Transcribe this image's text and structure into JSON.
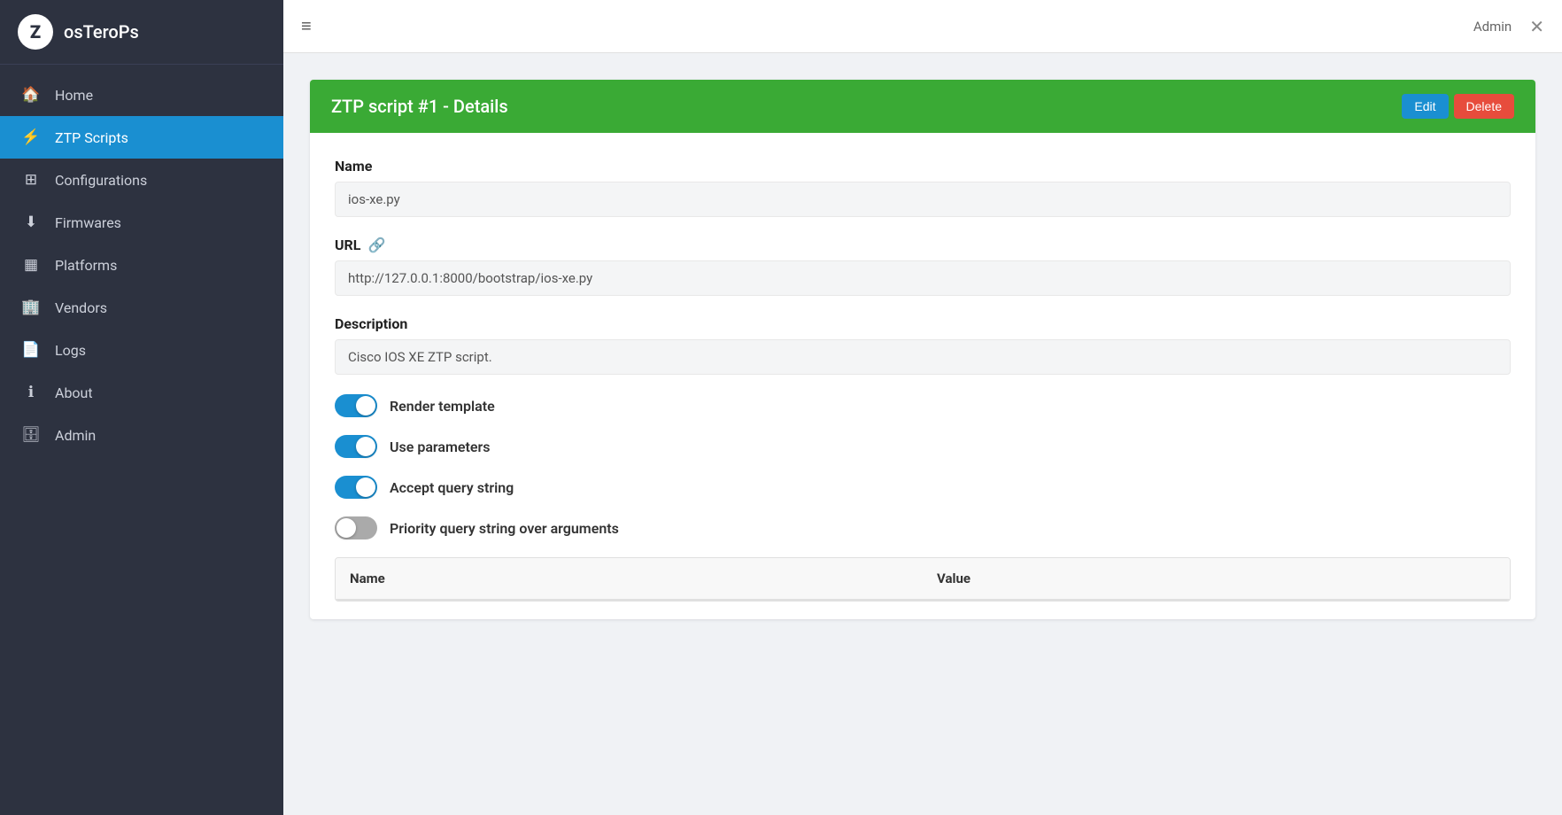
{
  "app": {
    "logo_letter": "Z",
    "title": "osTeroPs"
  },
  "sidebar": {
    "items": [
      {
        "id": "home",
        "label": "Home",
        "icon": "🏠",
        "active": false
      },
      {
        "id": "ztp-scripts",
        "label": "ZTP Scripts",
        "icon": "⚡",
        "active": true
      },
      {
        "id": "configurations",
        "label": "Configurations",
        "icon": "⊞",
        "active": false
      },
      {
        "id": "firmwares",
        "label": "Firmwares",
        "icon": "⬇",
        "active": false
      },
      {
        "id": "platforms",
        "label": "Platforms",
        "icon": "▦",
        "active": false
      },
      {
        "id": "vendors",
        "label": "Vendors",
        "icon": "🏢",
        "active": false
      },
      {
        "id": "logs",
        "label": "Logs",
        "icon": "📄",
        "active": false
      },
      {
        "id": "about",
        "label": "About",
        "icon": "ℹ",
        "active": false
      },
      {
        "id": "admin",
        "label": "Admin",
        "icon": "🗄",
        "active": false
      }
    ]
  },
  "topbar": {
    "hamburger_label": "≡",
    "user_label": "Admin",
    "close_label": "✕"
  },
  "detail": {
    "title": "ZTP script #1 - Details",
    "edit_label": "Edit",
    "delete_label": "Delete",
    "name_label": "Name",
    "name_value": "ios-xe.py",
    "url_label": "URL",
    "url_value": "http://127.0.0.1:8000/bootstrap/ios-xe.py",
    "description_label": "Description",
    "description_value": "Cisco IOS XE ZTP script.",
    "toggles": [
      {
        "id": "render-template",
        "label": "Render template",
        "on": true
      },
      {
        "id": "use-parameters",
        "label": "Use parameters",
        "on": true
      },
      {
        "id": "accept-query-string",
        "label": "Accept query string",
        "on": true
      },
      {
        "id": "priority-query-string",
        "label": "Priority query string over arguments",
        "on": false
      }
    ],
    "table_columns": [
      {
        "id": "name",
        "label": "Name"
      },
      {
        "id": "value",
        "label": "Value"
      }
    ]
  }
}
